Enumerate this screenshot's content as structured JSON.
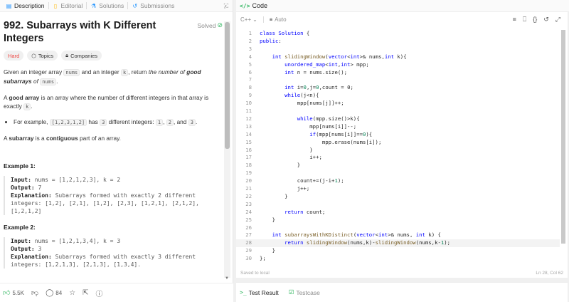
{
  "left_tabs": [
    {
      "label": "Description",
      "icon": "description-icon",
      "active": true
    },
    {
      "label": "Editorial",
      "icon": "editorial-icon",
      "active": false
    },
    {
      "label": "Solutions",
      "icon": "flask-icon",
      "active": false
    },
    {
      "label": "Submissions",
      "icon": "history-icon",
      "active": false
    }
  ],
  "problem": {
    "title": "992. Subarrays with K Different Integers",
    "status": "Solved",
    "difficulty": "Hard",
    "topics_label": "Topics",
    "companies_label": "Companies"
  },
  "description": {
    "p1_a": "Given an integer array ",
    "p1_code1": "nums",
    "p1_b": " and an integer ",
    "p1_code2": "k",
    "p1_c": ", return ",
    "p1_em": "the number of ",
    "p1_strong": "good subarrays",
    "p1_em2": " of ",
    "p1_code3": "nums",
    "p1_d": ".",
    "p2_a": "A ",
    "p2_strong": "good array",
    "p2_b": " is an array where the number of different integers in that array is exactly ",
    "p2_code": "k",
    "p2_c": ".",
    "bullet_a": "For example, ",
    "bullet_code1": "[1,2,3,1,2]",
    "bullet_b": " has ",
    "bullet_code2": "3",
    "bullet_c": " different integers: ",
    "bullet_code3": "1",
    "bullet_d": ", ",
    "bullet_code4": "2",
    "bullet_e": ", and ",
    "bullet_code5": "3",
    "bullet_f": ".",
    "p3_a": "A ",
    "p3_strong1": "subarray",
    "p3_b": " is a ",
    "p3_strong2": "contiguous",
    "p3_c": " part of an array."
  },
  "examples": [
    {
      "title": "Example 1:",
      "input_label": "Input:",
      "input": " nums = [1,2,1,2,3], k = 2",
      "output_label": "Output:",
      "output": " 7",
      "expl_label": "Explanation:",
      "expl_l1": " Subarrays formed with exactly 2 different",
      "expl_l2": "integers: [1,2], [2,1], [1,2], [2,3], [1,2,1], [2,1,2],",
      "expl_l3": "[1,2,1,2]"
    },
    {
      "title": "Example 2:",
      "input_label": "Input:",
      "input": " nums = [1,2,1,3,4], k = 3",
      "output_label": "Output:",
      "output": " 3",
      "expl_label": "Explanation:",
      "expl_l1": " Subarrays formed with exactly 3 different",
      "expl_l2": "integers: [1,2,1,3], [2,1,3], [1,3,4]."
    }
  ],
  "bottom_bar": {
    "likes": "5.5K",
    "comments": "84"
  },
  "code_panel": {
    "title": "Code",
    "language": "C++",
    "mode": "Auto",
    "saved": "Saved to local",
    "cursor": "Ln 28, Col 62"
  },
  "code_lines": [
    "class Solution {",
    "public:",
    "",
    "    int slidingWindow(vector<int>& nums,int k){",
    "        unordered_map<int,int> mpp;",
    "        int n = nums.size();",
    "",
    "        int i=0,j=0,count = 0;",
    "        while(j<n){",
    "            mpp[nums[j]]++;",
    "",
    "            while(mpp.size()>k){",
    "                mpp[nums[i]]--;",
    "                if(mpp[nums[i]]==0){",
    "                    mpp.erase(nums[i]);",
    "                }",
    "                i++;",
    "            }",
    "",
    "            count+=(j-i+1);",
    "            j++;",
    "        }",
    "",
    "        return count;",
    "    }",
    "",
    "    int subarraysWithKDistinct(vector<int>& nums, int k) {",
    "        return slidingWindow(nums,k)-slidingWindow(nums,k-1);",
    "    }",
    "};"
  ],
  "current_line": 28,
  "results": {
    "test_result": "Test Result",
    "testcase": "Testcase"
  }
}
